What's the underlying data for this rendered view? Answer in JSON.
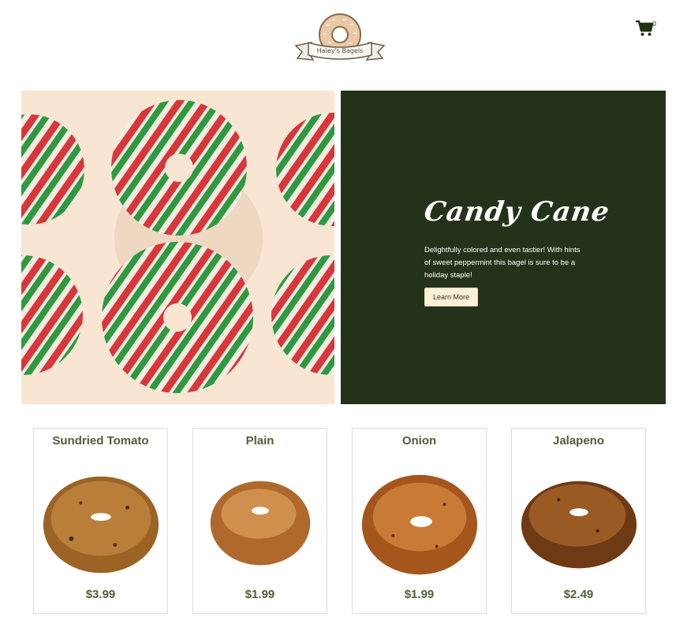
{
  "header": {
    "logo_text": "Haley's Bagels",
    "cart_count": "0"
  },
  "hero": {
    "title": "Candy Cane",
    "description": "Delightfully colored and even tastier! With hints of sweet peppermint this bagel is sure to be a holiday staple!",
    "button_label": "Learn More"
  },
  "products": [
    {
      "name": "Sundried Tomato",
      "price": "$3.99"
    },
    {
      "name": "Plain",
      "price": "$1.99"
    },
    {
      "name": "Onion",
      "price": "$1.99"
    },
    {
      "name": "Jalapeno",
      "price": "$2.49"
    }
  ],
  "colors": {
    "brand_green": "#25321a",
    "product_text": "#4f5f37",
    "button_bg": "#fdf0d6"
  }
}
